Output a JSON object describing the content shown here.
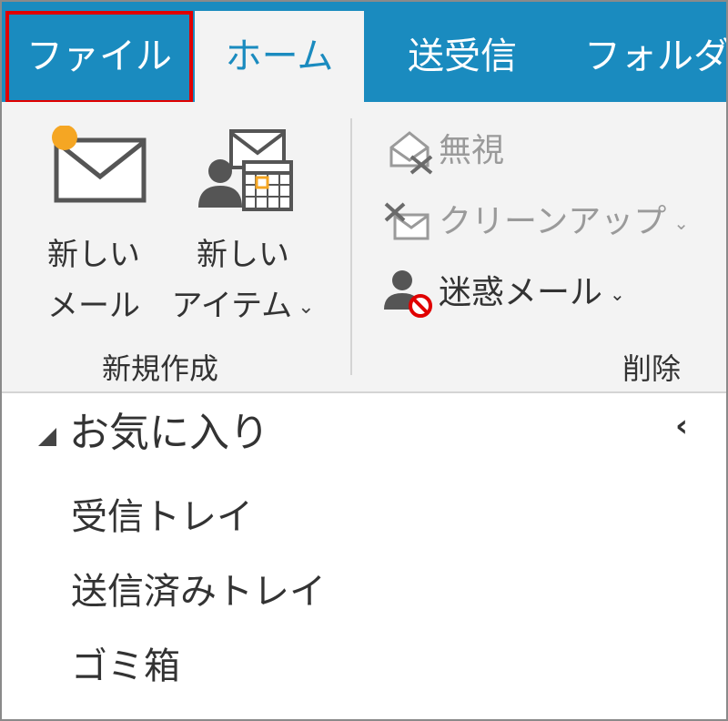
{
  "tabs": {
    "file": "ファイル",
    "home": "ホーム",
    "send_receive": "送受信",
    "folder": "フォルダー"
  },
  "ribbon": {
    "new_mail": {
      "line1": "新しい",
      "line2": "メール",
      "icon": "envelope-icon"
    },
    "new_item": {
      "line1": "新しい",
      "line2": "アイテム",
      "icon": "contact-calendar-icon",
      "has_dropdown": true
    },
    "group_new": "新規作成",
    "ignore": {
      "label": "無視",
      "icon": "ignore-envelope-icon",
      "enabled": false
    },
    "cleanup": {
      "label": "クリーンアップ",
      "icon": "cleanup-envelope-icon",
      "enabled": false,
      "has_dropdown": true
    },
    "junk": {
      "label": "迷惑メール",
      "icon": "junk-user-block-icon",
      "enabled": true,
      "has_dropdown": true
    },
    "group_delete": "削除"
  },
  "nav": {
    "favorites": "お気に入り",
    "collapse_glyph": "‹",
    "folders": [
      "受信トレイ",
      "送信済みトレイ",
      "ゴミ箱"
    ]
  },
  "colors": {
    "tabbar": "#1a8bbf",
    "highlight": "#e00000",
    "ribbon_bg": "#f3f3f3",
    "badge": "#f5a623",
    "block": "#e00000"
  }
}
